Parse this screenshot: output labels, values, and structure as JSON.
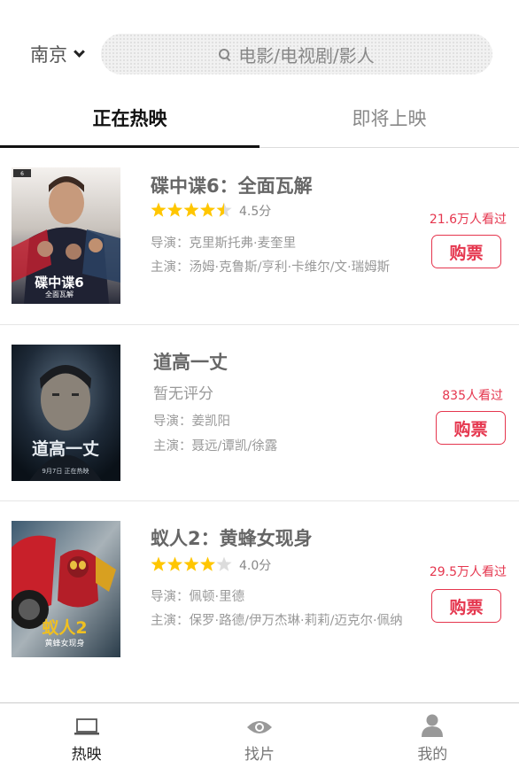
{
  "header": {
    "city": "南京",
    "search_placeholder": "电影/电视剧/影人"
  },
  "tabs": [
    {
      "label": "正在热映",
      "active": true
    },
    {
      "label": "即将上映",
      "active": false
    }
  ],
  "movies": [
    {
      "title": "碟中谍6：全面瓦解",
      "rating": 4.5,
      "score_text": "4.5分",
      "director": "导演：克里斯托弗·麦奎里",
      "cast": "主演：汤姆·克鲁斯/亨利·卡维尔/文·瑞姆斯",
      "watch": "21.6万人看过",
      "buy_label": "购票",
      "poster_text": "碟中谍6",
      "poster_sub": "全面瓦解"
    },
    {
      "title": "道高一丈",
      "score_text": "暂无评分",
      "director": "导演：姜凯阳",
      "cast": "主演：聂远/谭凯/徐露",
      "watch": "835人看过",
      "buy_label": "购票",
      "poster_text": "道高一丈",
      "poster_sub": "9月7日 正在热映"
    },
    {
      "title": "蚁人2：黄蜂女现身",
      "rating": 4.0,
      "score_text": "4.0分",
      "director": "导演：佩顿·里德",
      "cast": "主演：保罗·路德/伊万杰琳·莉莉/迈克尔·佩纳",
      "watch": "29.5万人看过",
      "buy_label": "购票",
      "poster_text": "蚁人2",
      "poster_sub": "黄蜂女现身"
    }
  ],
  "bottom_nav": [
    {
      "label": "热映",
      "icon": "laptop-icon",
      "active": true
    },
    {
      "label": "找片",
      "icon": "eye-icon",
      "active": false
    },
    {
      "label": "我的",
      "icon": "user-icon",
      "active": false
    }
  ],
  "colors": {
    "accent": "#e5364e",
    "star": "#ffc600",
    "star_empty": "#dcdcdc"
  }
}
